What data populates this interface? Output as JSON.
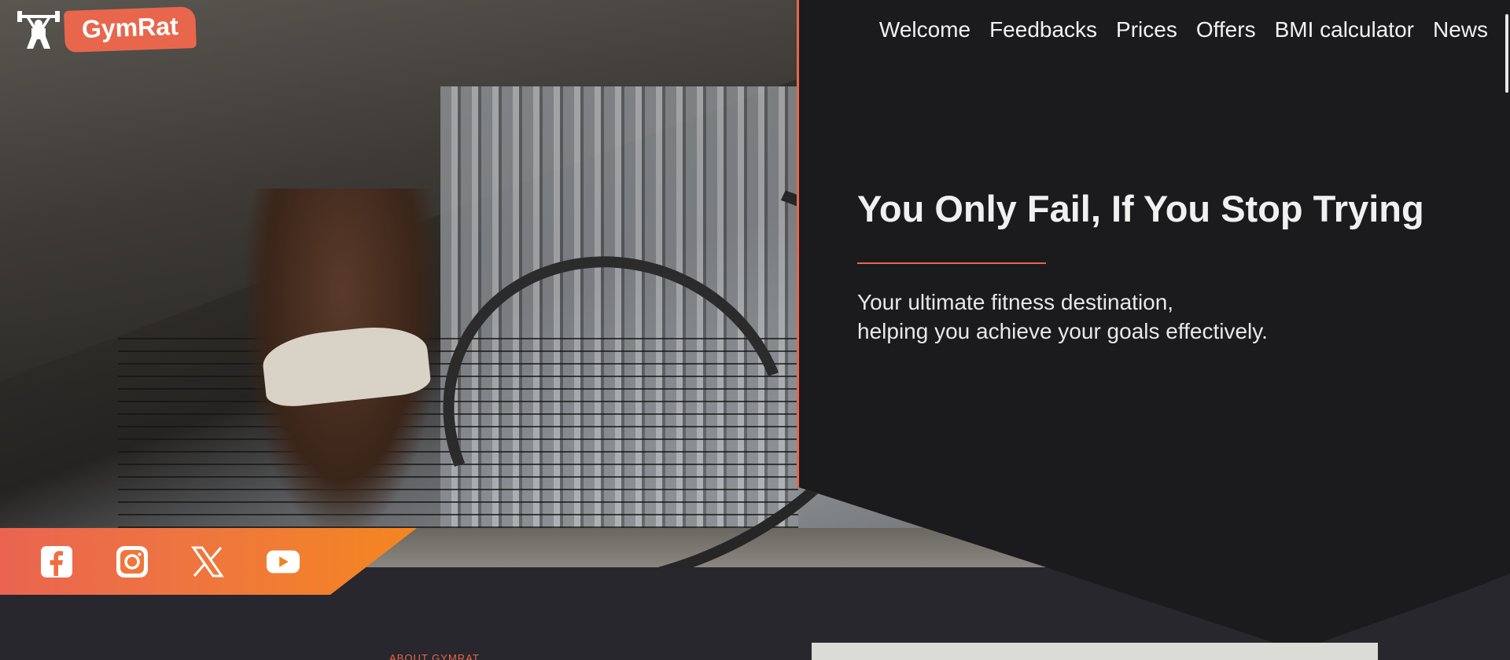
{
  "brand": {
    "name": "GymRat",
    "icon": "dumbbell-lifter-icon",
    "accent": "#e8674c"
  },
  "nav": {
    "items": [
      {
        "label": "Welcome"
      },
      {
        "label": "Feedbacks"
      },
      {
        "label": "Prices"
      },
      {
        "label": "Offers"
      },
      {
        "label": "BMI calculator"
      },
      {
        "label": "News"
      }
    ]
  },
  "hero": {
    "title": "You Only Fail, If You Stop Trying",
    "subtitle_line1": "Your ultimate fitness destination,",
    "subtitle_line2": "helping you achieve your goals effectively.",
    "image": "athlete-battle-ropes-photo"
  },
  "social": {
    "icons": [
      "facebook-icon",
      "instagram-icon",
      "x-icon",
      "youtube-icon"
    ],
    "gradient_start": "#ea6450",
    "gradient_end": "#f5861f"
  },
  "about": {
    "label": "ABOUT GYMRAT"
  },
  "colors": {
    "background": "#1b1b1e",
    "section_bg": "#27272d",
    "text": "#f0f0f0"
  }
}
